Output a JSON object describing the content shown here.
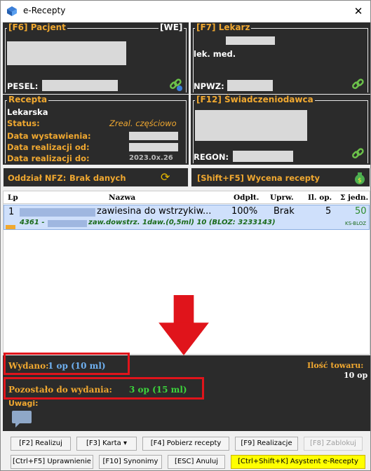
{
  "window": {
    "title": "e-Recepty",
    "close": "✕"
  },
  "pacjent": {
    "title": "[F6] Pacjent",
    "we": "[WE]",
    "pesel_label": "PESEL:"
  },
  "lekarz": {
    "title": "[F7] Lekarz",
    "prefix": "lek. med.",
    "npwz_label": "NPWZ:"
  },
  "recepta": {
    "title": "Recepta",
    "type": "Lekarska",
    "status_label": "Status:",
    "status_value": "Zreal. częściowo",
    "issued_label": "Data wystawienia:",
    "from_label": "Data realizacji od:",
    "to_label": "Data realizacji do:",
    "to_value_partial": "2023.0x.26"
  },
  "swiadczeniodawca": {
    "title": "[F12] Świadczeniodawca",
    "regon_label": "REGON:"
  },
  "nfz": {
    "label": "Oddział NFZ:",
    "value": "Brak danych"
  },
  "wycena": {
    "label": "[Shift+F5] Wycena recepty"
  },
  "table": {
    "headers": {
      "lp": "Lp",
      "nazwa": "Nazwa",
      "odplt": "Odpłt.",
      "uprw": "Uprw.",
      "ilop": "Il. op.",
      "jedn": "Σ jedn."
    },
    "rows": [
      {
        "lp": "1",
        "name": "zawiesina do wstrzykiw...",
        "odplt": "100%",
        "uprw": "Brak",
        "ilop": "5",
        "jedn": "50",
        "sub_prefix": "4361 -",
        "sub_text": "zaw.dowstrz. 1daw.(0,5ml) 10 (BLOZ: 3233143)",
        "badge": "KS-BLOZ"
      }
    ]
  },
  "footer": {
    "wydano_label": "Wydano:",
    "wydano_value": "1 op (10 ml)",
    "ilosc_label": "Ilość towaru:",
    "ilosc_value": "10 op",
    "pozostalo_label": "Pozostało do wydania:",
    "pozostalo_value": "3 op (15 ml)",
    "uwagi_label": "Uwagi:"
  },
  "buttons": {
    "realizuj": "[F2] Realizuj",
    "karta": "[F3] Karta ▾",
    "pobierz": "[F4] Pobierz recepty",
    "realizacje": "[F9] Realizacje",
    "zablokuj": "[F8] Zablokuj",
    "uprawnienie": "[Ctrl+F5] Uprawnienie",
    "synonimy": "[F10] Synonimy",
    "anuluj": "[ESC] Anuluj",
    "asystent": "[Ctrl+Shift+K] Asystent e-Recepty"
  },
  "colors": {
    "orange_label": "#f0a830",
    "panel_bg": "#2b2b2b",
    "blue_value": "#6fb0f0",
    "green_value": "#3cd43c",
    "highlight_red": "#e0141b",
    "row_bg": "#cfe0fb"
  }
}
